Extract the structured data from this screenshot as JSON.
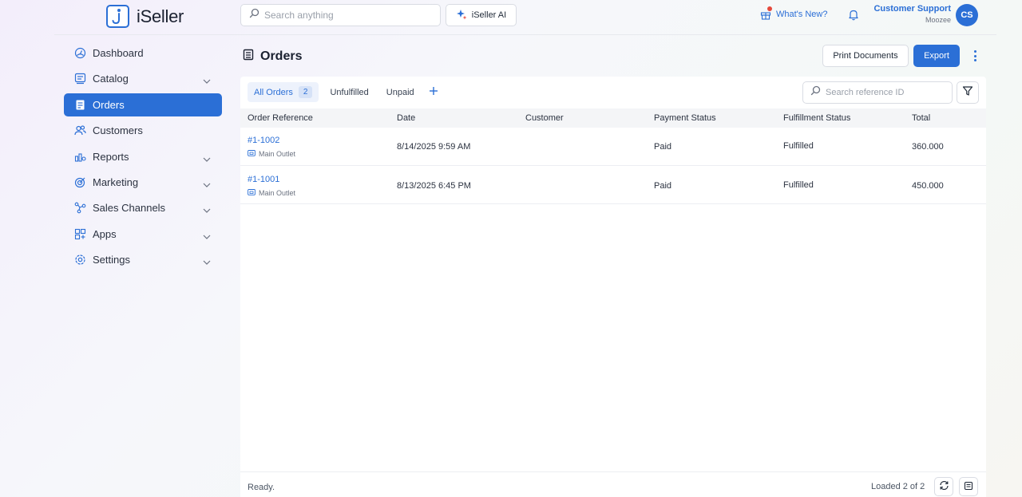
{
  "app": {
    "name": "iSeller"
  },
  "header": {
    "search_placeholder": "Search anything",
    "ai_label": "iSeller AI",
    "whats_new": "What's New?",
    "user_name": "Customer Support",
    "user_org": "Moozee",
    "avatar_initials": "CS"
  },
  "sidebar": {
    "items": [
      {
        "label": "Dashboard",
        "icon": "dashboard-icon",
        "expandable": false,
        "active": false
      },
      {
        "label": "Catalog",
        "icon": "catalog-icon",
        "expandable": true,
        "active": false
      },
      {
        "label": "Orders",
        "icon": "orders-icon",
        "expandable": false,
        "active": true
      },
      {
        "label": "Customers",
        "icon": "customers-icon",
        "expandable": false,
        "active": false
      },
      {
        "label": "Reports",
        "icon": "reports-icon",
        "expandable": true,
        "active": false
      },
      {
        "label": "Marketing",
        "icon": "marketing-icon",
        "expandable": true,
        "active": false
      },
      {
        "label": "Sales Channels",
        "icon": "sales-channels-icon",
        "expandable": true,
        "active": false
      },
      {
        "label": "Apps",
        "icon": "apps-icon",
        "expandable": true,
        "active": false
      },
      {
        "label": "Settings",
        "icon": "settings-icon",
        "expandable": true,
        "active": false
      }
    ]
  },
  "page": {
    "title": "Orders",
    "print_label": "Print Documents",
    "export_label": "Export"
  },
  "tabs": [
    {
      "label": "All Orders",
      "count": "2",
      "active": true
    },
    {
      "label": "Unfulfilled",
      "active": false
    },
    {
      "label": "Unpaid",
      "active": false
    }
  ],
  "ref_search_placeholder": "Search reference ID",
  "table": {
    "headers": [
      "Order Reference",
      "Date",
      "Customer",
      "Payment Status",
      "Fulfillment Status",
      "Total"
    ],
    "rows": [
      {
        "reference": "#1-1002",
        "outlet": "Main Outlet",
        "date": "8/14/2025 9:59 AM",
        "customer": "",
        "payment": "Paid",
        "fulfillment": "Fulfilled",
        "total": "360.000"
      },
      {
        "reference": "#1-1001",
        "outlet": "Main Outlet",
        "date": "8/13/2025 6:45 PM",
        "customer": "",
        "payment": "Paid",
        "fulfillment": "Fulfilled",
        "total": "450.000"
      }
    ]
  },
  "footer": {
    "status": "Ready.",
    "loaded": "Loaded 2 of 2"
  },
  "colors": {
    "accent": "#2b6fd6",
    "notification_dot": "#e5483b"
  }
}
